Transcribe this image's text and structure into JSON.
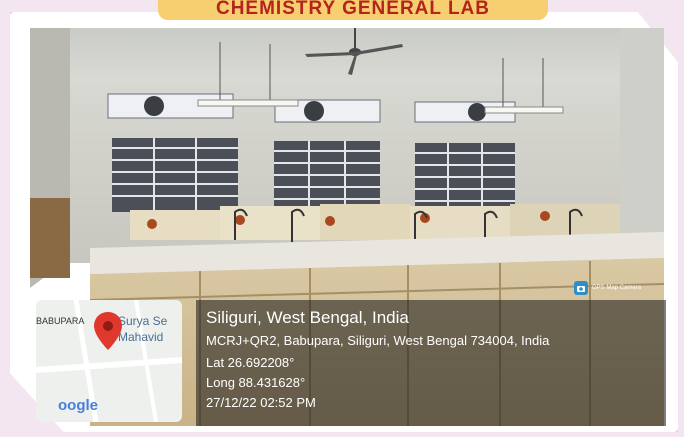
{
  "banner": {
    "title": "CHEMISTRY GENERAL LAB"
  },
  "photo": {
    "description_icon": "camera-photo"
  },
  "badge": {
    "label": "GPS Map Camera",
    "icon": "gps-camera-icon",
    "color": "#2f8ec9"
  },
  "map": {
    "area_label": "BABUPARA",
    "place_lines": [
      "Surya Se",
      "Mahavid"
    ],
    "logo_text": "oogle",
    "pin_icon": "map-pin-icon",
    "pin_color": "#e0382c"
  },
  "geotag": {
    "title": "Siliguri, West Bengal, India",
    "address": "MCRJ+QR2, Babupara, Siliguri, West Bengal 734004, India",
    "lat": "Lat 26.692208°",
    "long": "Long 88.431628°",
    "datetime": "27/12/22 02:52 PM"
  }
}
